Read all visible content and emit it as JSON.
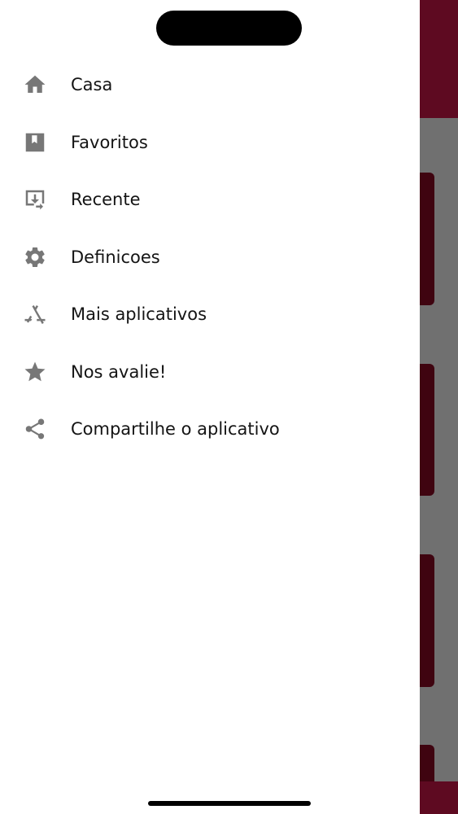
{
  "menu": {
    "items": [
      {
        "label": "Casa",
        "icon": "home-icon"
      },
      {
        "label": "Favoritos",
        "icon": "bookmark-icon"
      },
      {
        "label": "Recente",
        "icon": "recent-icon"
      },
      {
        "label": "Definicoes",
        "icon": "gear-icon"
      },
      {
        "label": "Mais aplicativos",
        "icon": "app-store-icon"
      },
      {
        "label": "Nos avalie!",
        "icon": "star-icon"
      },
      {
        "label": "Compartilhe o aplicativo",
        "icon": "share-icon"
      }
    ]
  },
  "colors": {
    "icon": "#777777",
    "text": "#141414",
    "drawer_background": "#ffffff",
    "background_header": "#5e0a21",
    "background_card": "#3f0410",
    "scrim": "#707070"
  }
}
